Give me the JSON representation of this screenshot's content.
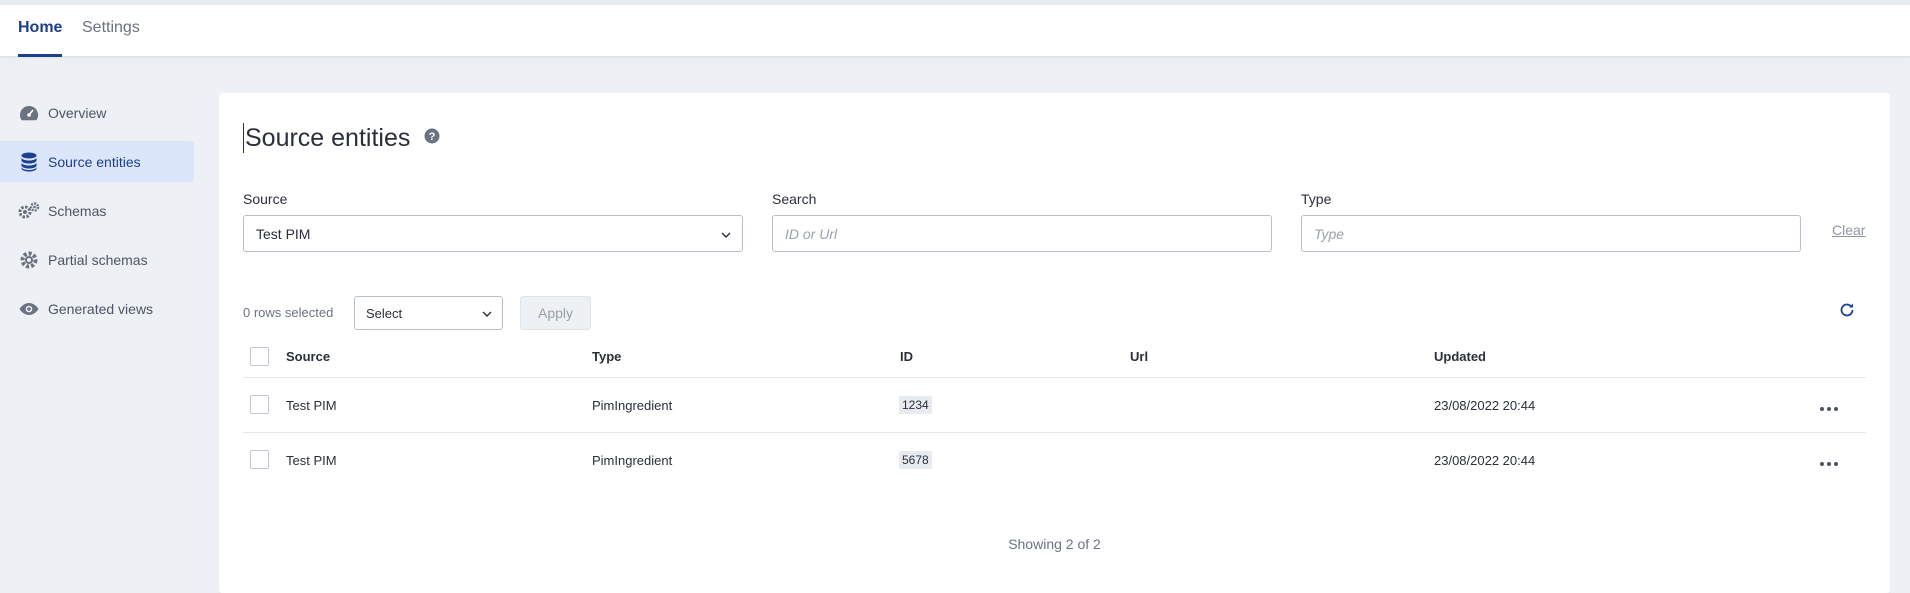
{
  "nav": {
    "tabs": [
      {
        "label": "Home",
        "active": true
      },
      {
        "label": "Settings",
        "active": false
      }
    ]
  },
  "sidebar": {
    "items": [
      {
        "label": "Overview",
        "icon": "dashboard-icon"
      },
      {
        "label": "Source entities",
        "icon": "database-icon",
        "active": true
      },
      {
        "label": "Schemas",
        "icon": "gears-icon"
      },
      {
        "label": "Partial schemas",
        "icon": "gear-icon"
      },
      {
        "label": "Generated views",
        "icon": "eye-icon"
      }
    ]
  },
  "page": {
    "title": "Source entities"
  },
  "filters": {
    "source_label": "Source",
    "source_value": "Test PIM",
    "search_label": "Search",
    "search_placeholder": "ID or Url",
    "type_label": "Type",
    "type_placeholder": "Type",
    "clear_label": "Clear"
  },
  "bulk": {
    "rows_selected": "0 rows selected",
    "select_value": "Select",
    "apply_label": "Apply"
  },
  "table": {
    "headers": [
      "Source",
      "Type",
      "ID",
      "Url",
      "Updated"
    ],
    "rows": [
      {
        "source": "Test PIM",
        "type": "PimIngredient",
        "id": "1234",
        "url": "",
        "updated": "23/08/2022 20:44"
      },
      {
        "source": "Test PIM",
        "type": "PimIngredient",
        "id": "5678",
        "url": "",
        "updated": "23/08/2022 20:44"
      }
    ]
  },
  "footer": {
    "count": "Showing 2 of 2"
  },
  "colors": {
    "accent": "#1d3f8f",
    "active_bg": "#dce6fb",
    "page_bg": "#edf1f5"
  }
}
